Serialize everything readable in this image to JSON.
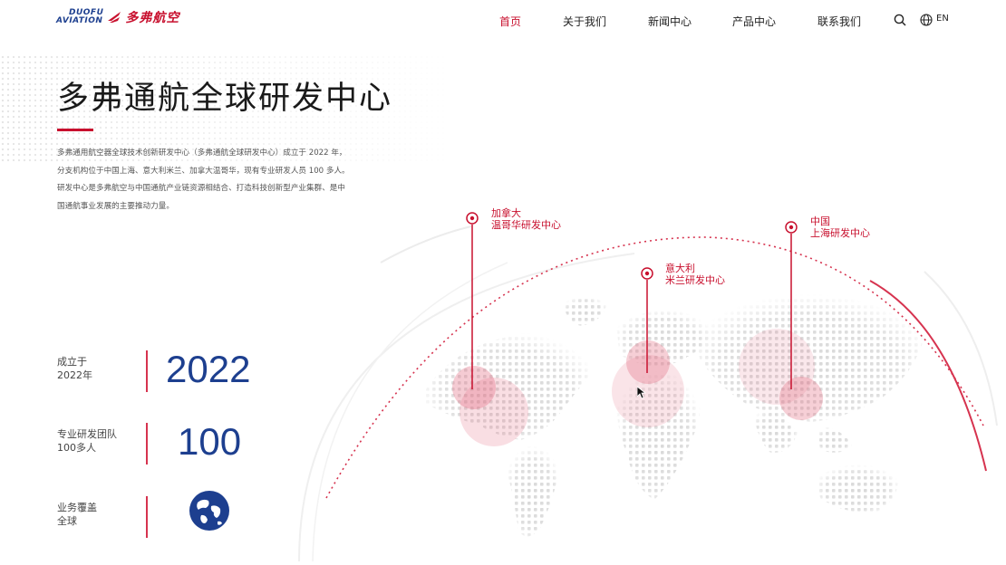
{
  "brand": {
    "name_en_line1": "DUOFU",
    "name_en_line2": "AVIATION",
    "name_cn": "多弗航空",
    "brand_red": "#c8102e",
    "brand_blue": "#1d3f8f"
  },
  "nav": {
    "items": [
      {
        "label": "首页",
        "active": true
      },
      {
        "label": "关于我们",
        "active": false
      },
      {
        "label": "新闻中心",
        "active": false
      },
      {
        "label": "产品中心",
        "active": false
      },
      {
        "label": "联系我们",
        "active": false
      }
    ],
    "search_icon": "search-icon",
    "language_icon": "globe-icon",
    "language_label": "EN"
  },
  "main": {
    "title": "多弗通航全球研发中心",
    "intro": [
      "多弗通用航空器全球技术创新研发中心（多弗通航全球研发中心）成立于 2022 年，",
      "分支机构位于中国上海、意大利米兰、加拿大温哥华，现有专业研发人员 100 多人。",
      "研发中心是多弗航空与中国通航产业链资源相结合、打造科技创新型产业集群、是中",
      "国通航事业发展的主要推动力量。"
    ]
  },
  "stats": [
    {
      "label_line1": "成立于",
      "label_line2": "2022年",
      "value": "2022"
    },
    {
      "label_line1": "专业研发团队",
      "label_line2": "100多人",
      "value": "100"
    },
    {
      "label_line1": "业务覆盖",
      "label_line2": "全球",
      "value_icon": "globe-icon"
    }
  ],
  "map": {
    "locations": [
      {
        "line1": "加拿大",
        "line2": "温哥华研发中心"
      },
      {
        "line1": "意大利",
        "line2": "米兰研发中心"
      },
      {
        "line1": "中国",
        "line2": "上海研发中心"
      }
    ]
  }
}
